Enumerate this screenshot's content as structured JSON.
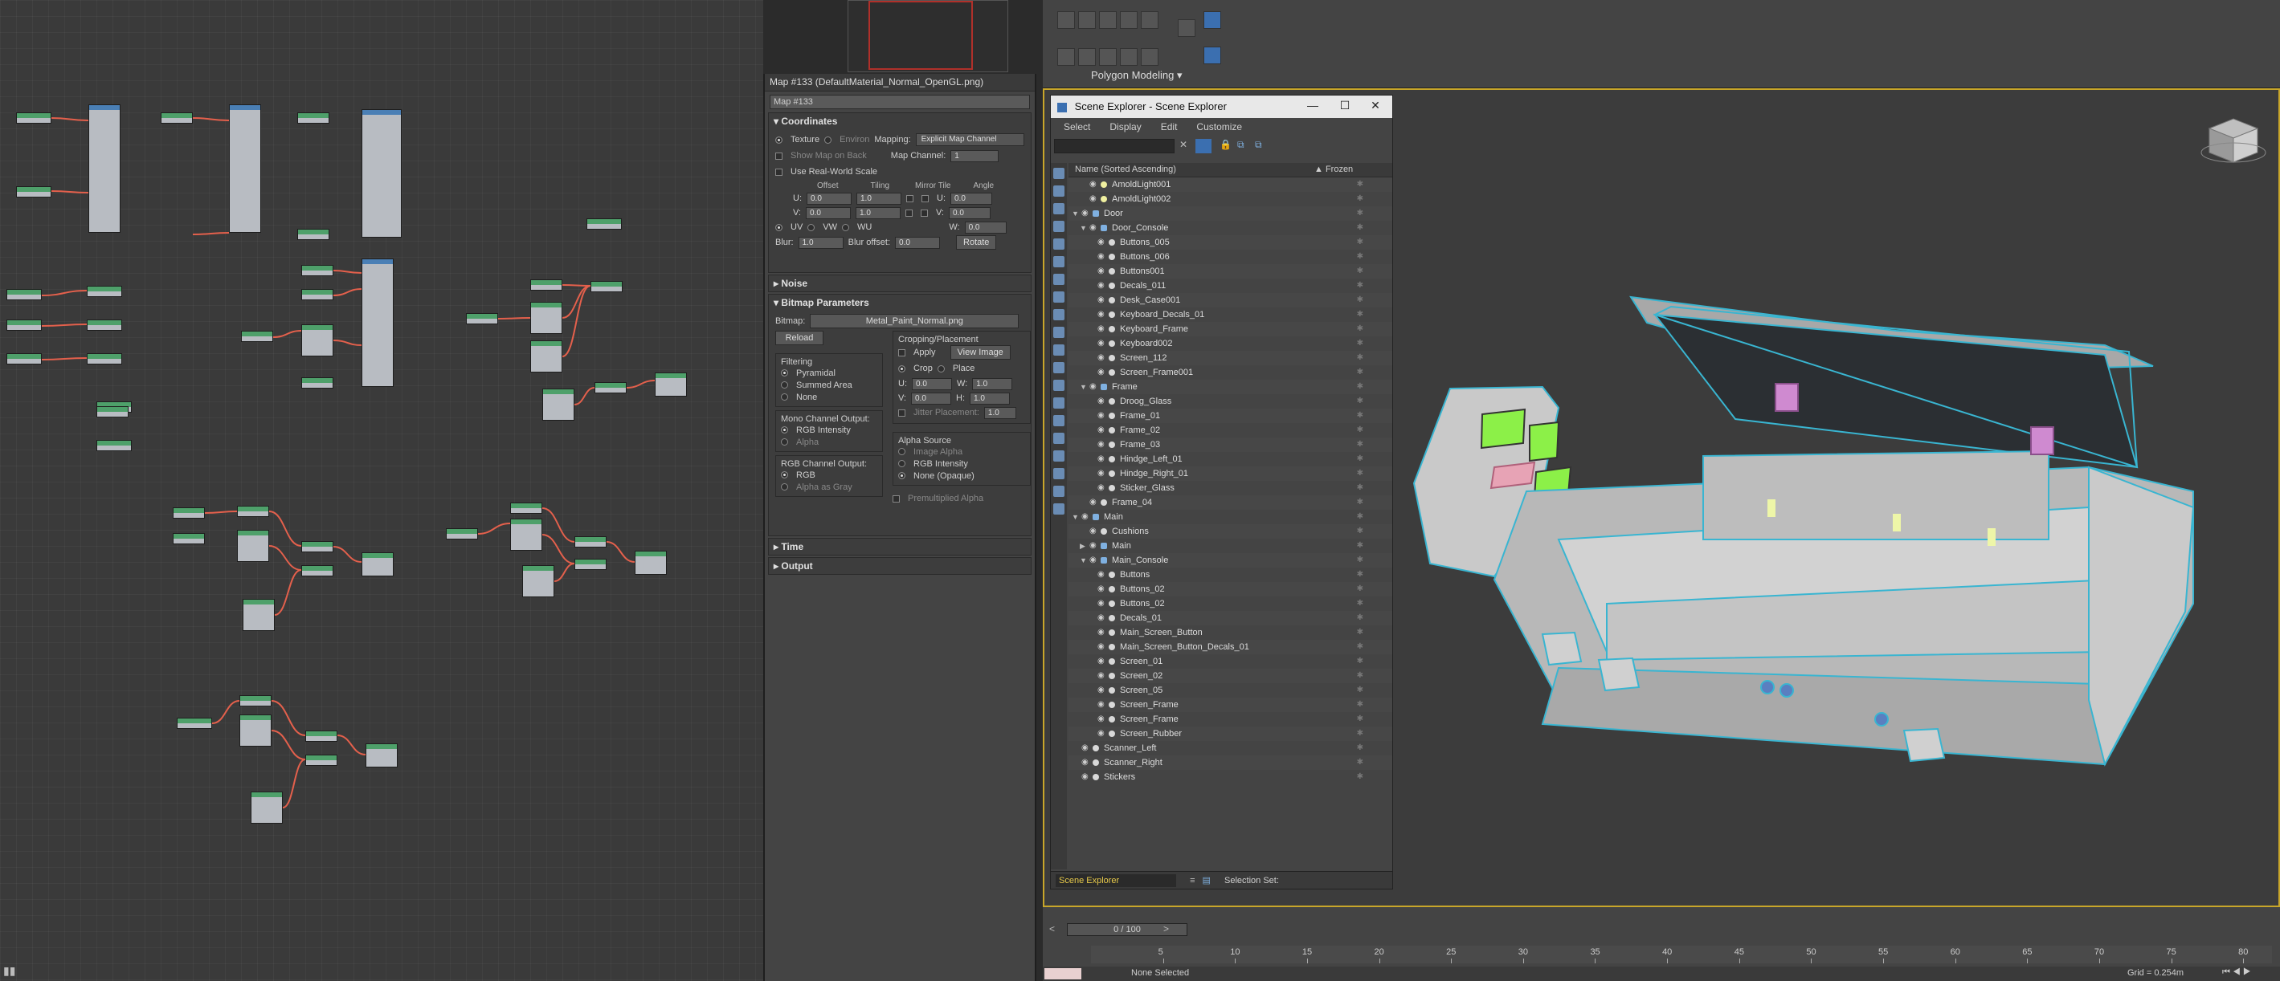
{
  "material_panel": {
    "title": "Map #133 (DefaultMaterial_Normal_OpenGL.png)",
    "map_name": "Map #133",
    "coordinates": {
      "heading": "Coordinates",
      "texture": "Texture",
      "environ": "Environ",
      "mapping_label": "Mapping:",
      "mapping_value": "Explicit Map Channel",
      "show_map_on_back": "Show Map on Back",
      "map_channel_label": "Map Channel:",
      "map_channel_value": "1",
      "real_world": "Use Real-World Scale",
      "col_offset": "Offset",
      "col_tiling": "Tiling",
      "col_mirror_tile": "Mirror Tile",
      "col_angle": "Angle",
      "u_label": "U:",
      "v_label": "V:",
      "w_label": "W:",
      "u_offset": "0.0",
      "v_offset": "0.0",
      "u_tiling": "1.0",
      "v_tiling": "1.0",
      "u_angle": "0.0",
      "v_angle": "0.0",
      "w_angle": "0.0",
      "uv": "UV",
      "vw": "VW",
      "wu": "WU",
      "blur_label": "Blur:",
      "blur_value": "1.0",
      "blur_offset_label": "Blur offset:",
      "blur_offset_value": "0.0",
      "rotate": "Rotate"
    },
    "noise": "Noise",
    "bitmap": {
      "heading": "Bitmap Parameters",
      "bitmap_label": "Bitmap:",
      "bitmap_value": "Metal_Paint_Normal.png",
      "reload": "Reload",
      "cropping_heading": "Cropping/Placement",
      "apply": "Apply",
      "view_image": "View Image",
      "crop": "Crop",
      "place": "Place",
      "u_label": "U:",
      "u_value": "0.0",
      "w_label": "W:",
      "w_value": "1.0",
      "v_label": "V:",
      "v_value": "0.0",
      "h_label": "H:",
      "h_value": "1.0",
      "jitter": "Jitter Placement:",
      "jitter_value": "1.0",
      "filtering": "Filtering",
      "pyramidal": "Pyramidal",
      "summed_area": "Summed Area",
      "none": "None",
      "mono_heading": "Mono Channel Output:",
      "rgb_intensity": "RGB Intensity",
      "alpha": "Alpha",
      "rgb_heading": "RGB Channel Output:",
      "rgb": "RGB",
      "alpha_as_gray": "Alpha as Gray",
      "alpha_source": "Alpha Source",
      "image_alpha": "Image Alpha",
      "as_rgb_intensity": "RGB Intensity",
      "none_opaque": "None (Opaque)",
      "premultiplied": "Premultiplied Alpha"
    },
    "time": "Time",
    "output": "Output"
  },
  "toolbar": {
    "polygon_modeling": "Polygon Modeling"
  },
  "scene_explorer": {
    "title": "Scene Explorer - Scene Explorer",
    "menu": [
      "Select",
      "Display",
      "Edit",
      "Customize"
    ],
    "col_name": "Name (Sorted Ascending)",
    "col_frozen": "▲ Frozen",
    "rows": [
      {
        "name": "AmoldLight001",
        "depth": 1,
        "kind": "light",
        "exp": ""
      },
      {
        "name": "AmoldLight002",
        "depth": 1,
        "kind": "light",
        "exp": ""
      },
      {
        "name": "Door",
        "depth": 0,
        "kind": "group",
        "exp": "▼"
      },
      {
        "name": "Door_Console",
        "depth": 1,
        "kind": "group",
        "exp": "▼"
      },
      {
        "name": "Buttons_005",
        "depth": 2,
        "kind": "obj",
        "exp": ""
      },
      {
        "name": "Buttons_006",
        "depth": 2,
        "kind": "obj",
        "exp": ""
      },
      {
        "name": "Buttons001",
        "depth": 2,
        "kind": "obj",
        "exp": ""
      },
      {
        "name": "Decals_011",
        "depth": 2,
        "kind": "obj",
        "exp": ""
      },
      {
        "name": "Desk_Case001",
        "depth": 2,
        "kind": "obj",
        "exp": ""
      },
      {
        "name": "Keyboard_Decals_01",
        "depth": 2,
        "kind": "obj",
        "exp": ""
      },
      {
        "name": "Keyboard_Frame",
        "depth": 2,
        "kind": "obj",
        "exp": ""
      },
      {
        "name": "Keyboard002",
        "depth": 2,
        "kind": "obj",
        "exp": ""
      },
      {
        "name": "Screen_112",
        "depth": 2,
        "kind": "obj",
        "exp": ""
      },
      {
        "name": "Screen_Frame001",
        "depth": 2,
        "kind": "obj",
        "exp": ""
      },
      {
        "name": "Frame",
        "depth": 1,
        "kind": "group",
        "exp": "▼"
      },
      {
        "name": "Droog_Glass",
        "depth": 2,
        "kind": "obj",
        "exp": ""
      },
      {
        "name": "Frame_01",
        "depth": 2,
        "kind": "obj",
        "exp": ""
      },
      {
        "name": "Frame_02",
        "depth": 2,
        "kind": "obj",
        "exp": ""
      },
      {
        "name": "Frame_03",
        "depth": 2,
        "kind": "obj",
        "exp": ""
      },
      {
        "name": "Hindge_Left_01",
        "depth": 2,
        "kind": "obj",
        "exp": ""
      },
      {
        "name": "Hindge_Right_01",
        "depth": 2,
        "kind": "obj",
        "exp": ""
      },
      {
        "name": "Sticker_Glass",
        "depth": 2,
        "kind": "obj",
        "exp": ""
      },
      {
        "name": "Frame_04",
        "depth": 1,
        "kind": "obj",
        "exp": ""
      },
      {
        "name": "Main",
        "depth": 0,
        "kind": "group",
        "exp": "▼"
      },
      {
        "name": "Cushions",
        "depth": 1,
        "kind": "obj",
        "exp": ""
      },
      {
        "name": "Main",
        "depth": 1,
        "kind": "group",
        "exp": "▶"
      },
      {
        "name": "Main_Console",
        "depth": 1,
        "kind": "group",
        "exp": "▼"
      },
      {
        "name": "Buttons",
        "depth": 2,
        "kind": "obj",
        "exp": ""
      },
      {
        "name": "Buttons_02",
        "depth": 2,
        "kind": "obj",
        "exp": ""
      },
      {
        "name": "Buttons_02",
        "depth": 2,
        "kind": "obj",
        "exp": ""
      },
      {
        "name": "Decals_01",
        "depth": 2,
        "kind": "obj",
        "exp": ""
      },
      {
        "name": "Main_Screen_Button",
        "depth": 2,
        "kind": "obj",
        "exp": ""
      },
      {
        "name": "Main_Screen_Button_Decals_01",
        "depth": 2,
        "kind": "obj",
        "exp": ""
      },
      {
        "name": "Screen_01",
        "depth": 2,
        "kind": "obj",
        "exp": ""
      },
      {
        "name": "Screen_02",
        "depth": 2,
        "kind": "obj",
        "exp": ""
      },
      {
        "name": "Screen_05",
        "depth": 2,
        "kind": "obj",
        "exp": ""
      },
      {
        "name": "Screen_Frame",
        "depth": 2,
        "kind": "obj",
        "exp": ""
      },
      {
        "name": "Screen_Frame",
        "depth": 2,
        "kind": "obj",
        "exp": ""
      },
      {
        "name": "Screen_Rubber",
        "depth": 2,
        "kind": "obj",
        "exp": ""
      },
      {
        "name": "Scanner_Left",
        "depth": 0,
        "kind": "obj",
        "exp": ""
      },
      {
        "name": "Scanner_Right",
        "depth": 0,
        "kind": "obj",
        "exp": ""
      },
      {
        "name": "Stickers",
        "depth": 0,
        "kind": "obj",
        "exp": ""
      }
    ],
    "explorer_select": "Scene Explorer",
    "selection_set": "Selection Set:"
  },
  "timeline": {
    "frame": "0 / 100",
    "ticks": [
      "5",
      "10",
      "15",
      "20",
      "25",
      "30",
      "35",
      "40",
      "45",
      "50",
      "55",
      "60",
      "65",
      "70",
      "75",
      "80"
    ],
    "none_selected": "None Selected",
    "grid": "Grid = 0.254m"
  },
  "colors": {
    "accent_viewport_border": "#c8a62a",
    "wire_cyan": "#39b5d1",
    "screen_green": "#8cf048",
    "node_link_red": "#e4604c"
  }
}
